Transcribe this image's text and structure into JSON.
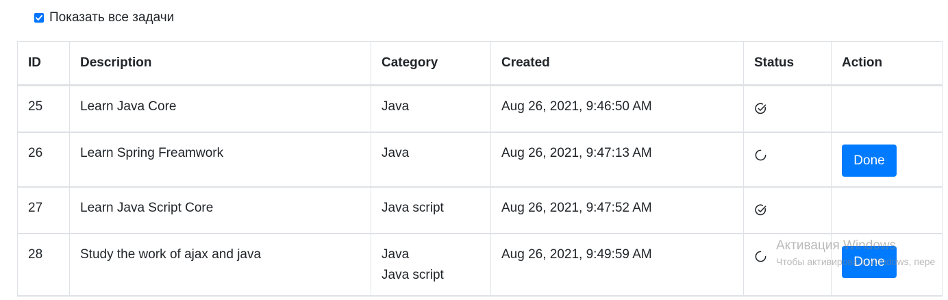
{
  "filter": {
    "show_all_label": "Показать все задачи",
    "checked": true
  },
  "table": {
    "headers": {
      "id": "ID",
      "description": "Description",
      "category": "Category",
      "created": "Created",
      "status": "Status",
      "action": "Action"
    },
    "rows": [
      {
        "id": "25",
        "description": "Learn Java Core",
        "categories": [
          "Java"
        ],
        "created": "Aug 26, 2021, 9:46:50 AM",
        "status_icon": "check-circle-icon",
        "action_label": ""
      },
      {
        "id": "26",
        "description": "Learn Spring Freamwork",
        "categories": [
          "Java"
        ],
        "created": "Aug 26, 2021, 9:47:13 AM",
        "status_icon": "loading-circle-icon",
        "action_label": "Done"
      },
      {
        "id": "27",
        "description": "Learn Java Script Core",
        "categories": [
          "Java script"
        ],
        "created": "Aug 26, 2021, 9:47:52 AM",
        "status_icon": "check-circle-icon",
        "action_label": ""
      },
      {
        "id": "28",
        "description": "Study the work of ajax and java",
        "categories": [
          "Java",
          "Java script"
        ],
        "created": "Aug 26, 2021, 9:49:59 AM",
        "status_icon": "loading-circle-icon",
        "action_label": "Done"
      }
    ]
  },
  "watermark": {
    "title": "Активация Windows",
    "subtitle": "Чтобы активировать Windows, пере"
  },
  "colors": {
    "accent": "#007bff",
    "border": "#dee2e6",
    "text": "#212529"
  }
}
